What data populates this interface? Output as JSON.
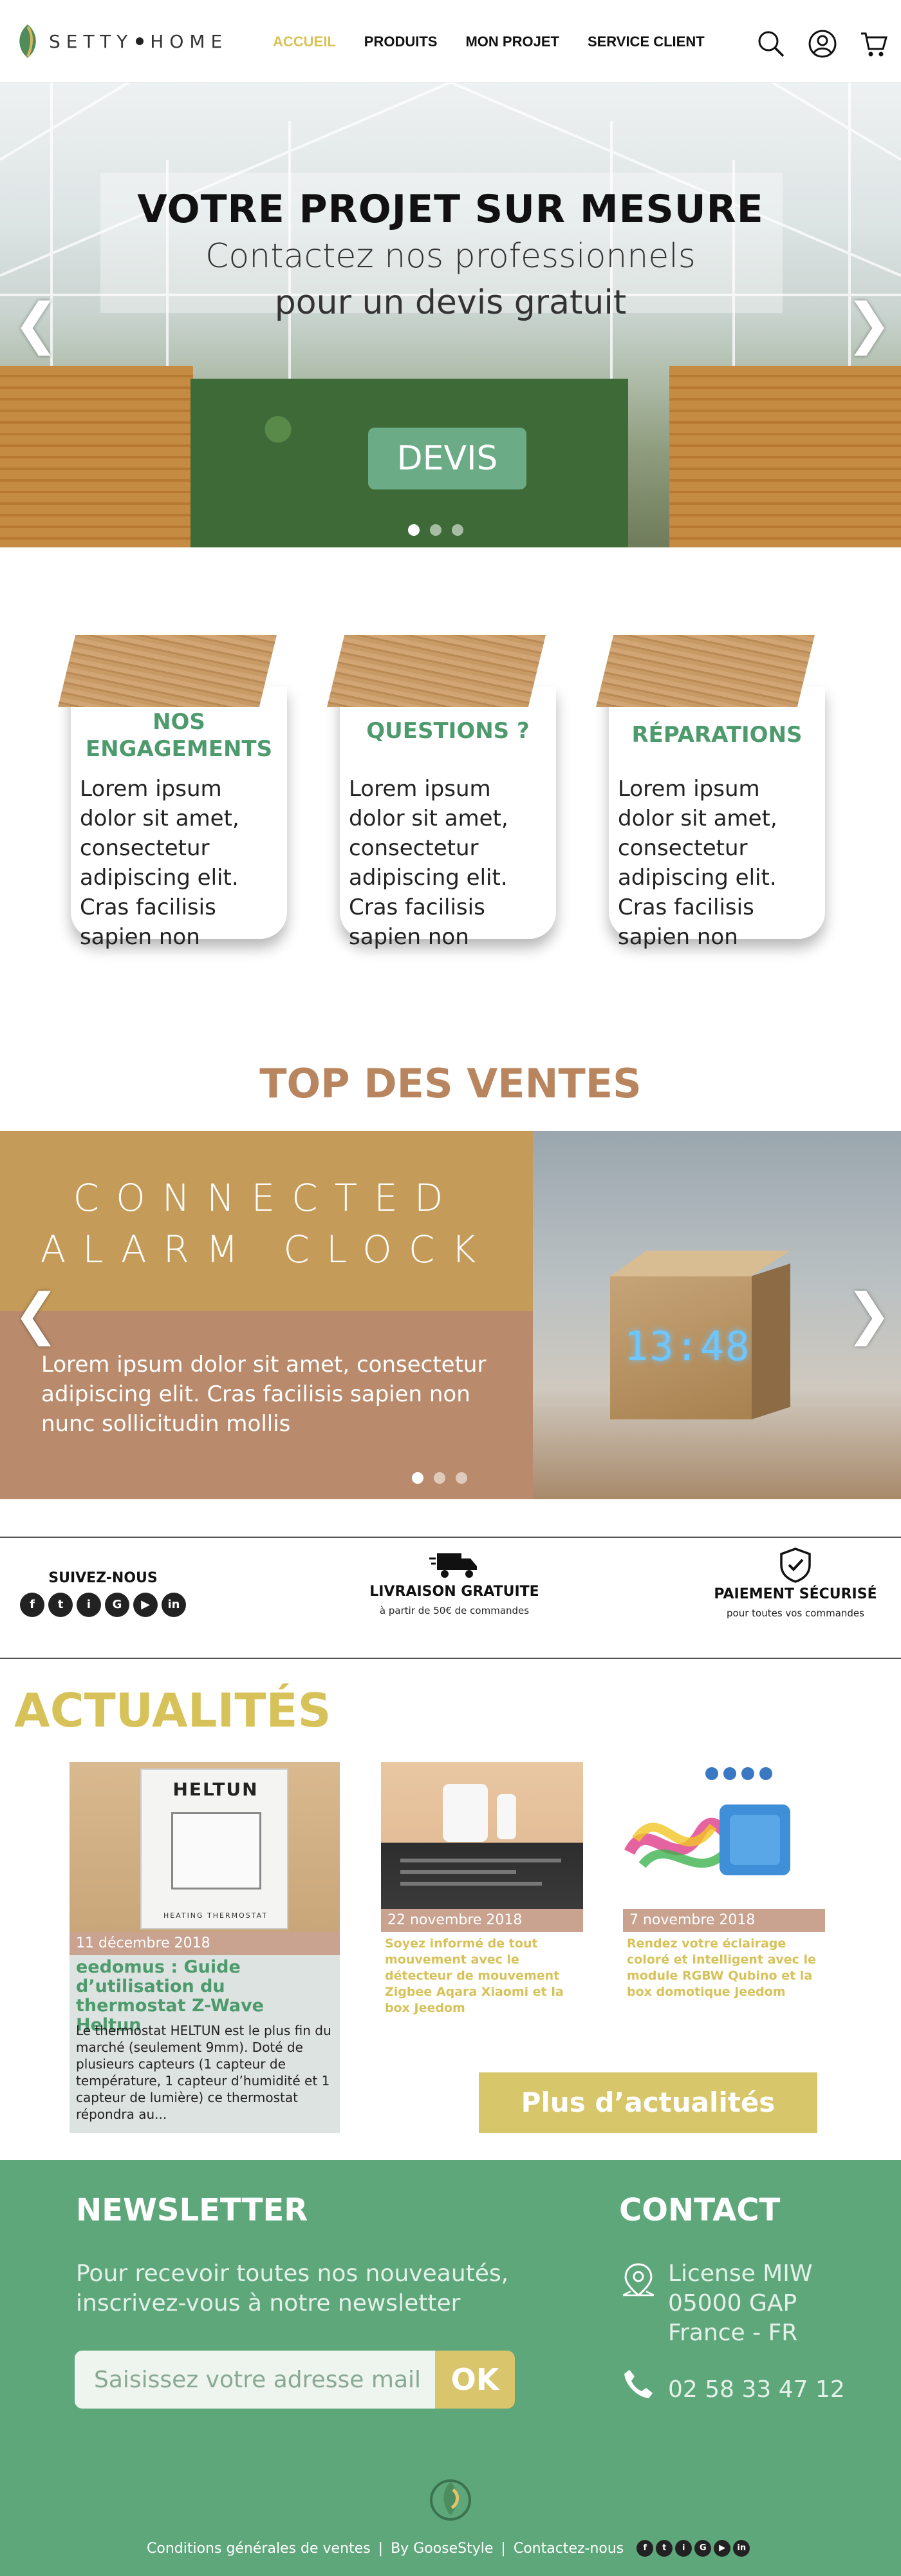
{
  "header": {
    "logo_left": "SETTY",
    "logo_right": "HOME",
    "nav": [
      "ACCUEIL",
      "PRODUITS",
      "MON PROJET",
      "SERVICE CLIENT"
    ]
  },
  "hero": {
    "title": "VOTRE PROJET SUR MESURE",
    "subtitle_line1": "Contactez nos professionnels",
    "subtitle_line2": "pour un devis gratuit",
    "button": "DEVIS",
    "arrow_left": "❮",
    "arrow_right": "❯"
  },
  "cards": [
    {
      "title_line1": "NOS",
      "title_line2": "ENGAGEMENTS",
      "text": "Lorem ipsum dolor sit amet, consectetur adipiscing elit. Cras facilisis sapien non"
    },
    {
      "title_line1": "QUESTIONS ?",
      "title_line2": "",
      "text": "Lorem ipsum dolor sit amet, consectetur adipiscing elit. Cras facilisis sapien non"
    },
    {
      "title_line1": "RÉPARATIONS",
      "title_line2": "",
      "text": "Lorem ipsum dolor sit amet, consectetur adipiscing elit. Cras facilisis sapien non"
    }
  ],
  "top_ventes": {
    "title": "TOP DES VENTES",
    "heading_line1": "CONNECTED",
    "heading_line2": "ALARM CLOCK",
    "text": "Lorem ipsum dolor sit amet, consectetur adipiscing elit. Cras facilisis sapien non nunc sollicitudin mollis",
    "clock_display": "13:48"
  },
  "info_bar": {
    "follow": "SUIVEZ-NOUS",
    "social": [
      "f",
      "t",
      "i",
      "G",
      "▶",
      "in"
    ],
    "delivery_title": "LIVRAISON GRATUITE",
    "delivery_sub": "à partir de 50€ de commandes",
    "payment_title": "PAIEMENT SÉCURISÉ",
    "payment_sub": "pour toutes vos commandes"
  },
  "actualites": {
    "title": "ACTUALITÉS",
    "featured": {
      "brand": "HELTUN",
      "product_label": "HEATING THERMOSTAT",
      "date": "11 décembre 2018",
      "title": "eedomus : Guide d’utilisation du thermostat Z-Wave Heltun",
      "text": "Le thermostat HELTUN est le plus fin du marché (seulement 9mm). Doté de plusieurs capteurs (1 capteur de température, 1 capteur d’humidité et 1 capteur de lumière) ce thermostat répondra au..."
    },
    "items": [
      {
        "date": "22 novembre 2018",
        "title": "Soyez informé de tout mouvement avec le détecteur de mouvement Zigbee Aqara Xiaomi et la box Jeedom"
      },
      {
        "date": "7 novembre 2018",
        "title": "Rendez votre éclairage coloré et intelligent avec le module RGBW Qubino et la box domotique Jeedom"
      }
    ],
    "more_button": "Plus d’actualités"
  },
  "footer": {
    "newsletter_title": "NEWSLETTER",
    "newsletter_text": "Pour recevoir toutes nos nouveautés, inscrivez-vous à notre newsletter",
    "newsletter_placeholder": "Saisissez votre adresse mail",
    "newsletter_button": "OK",
    "contact_title": "CONTACT",
    "address_line1": "License MIW",
    "address_line2": "05000 GAP",
    "address_line3": "France - FR",
    "phone": "02 58 33 47 12",
    "links": [
      "Conditions générales de ventes",
      "By GooseStyle",
      "Contactez-nous"
    ],
    "separator": "|"
  }
}
